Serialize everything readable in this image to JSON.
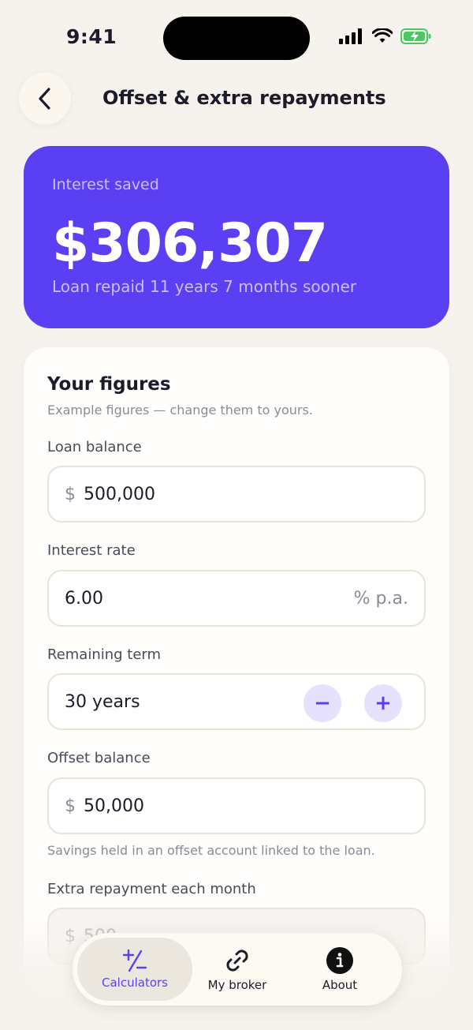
{
  "status": {
    "time": "9:41"
  },
  "header": {
    "title": "Offset & extra repayments"
  },
  "result": {
    "label": "Interest saved",
    "value": "$306,307",
    "subtitle": "Loan repaid 11 years 7 months sooner"
  },
  "form": {
    "title": "Your figures",
    "subtitle": "Example figures — change them to yours.",
    "loan_balance": {
      "label": "Loan balance",
      "prefix": "$",
      "value": "500,000"
    },
    "interest_rate": {
      "label": "Interest rate",
      "value": "6.00",
      "suffix": "% p.a."
    },
    "remaining_term": {
      "label": "Remaining term",
      "value": "30 years",
      "minus": "−",
      "plus": "+"
    },
    "offset_balance": {
      "label": "Offset balance",
      "prefix": "$",
      "value": "50,000",
      "hint": "Savings held in an offset account linked to the loan."
    },
    "extra_repayment": {
      "label": "Extra repayment each month",
      "prefix": "$",
      "value": "500"
    }
  },
  "tabs": [
    {
      "label": "Calculators",
      "icon": "plus-minus-icon",
      "active": true
    },
    {
      "label": "My broker",
      "icon": "link-icon",
      "active": false
    },
    {
      "label": "About",
      "icon": "info-icon",
      "active": false
    }
  ],
  "colors": {
    "accent": "#5b3ff2",
    "background": "#f6f3ee",
    "card": "#fffefc"
  }
}
